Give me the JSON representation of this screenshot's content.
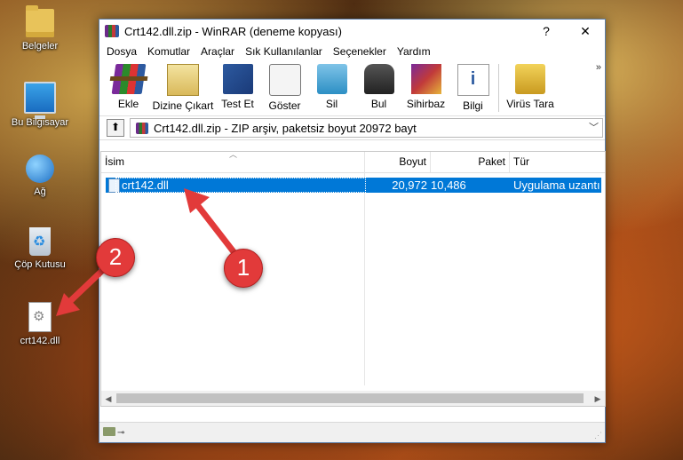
{
  "desktop": {
    "icons": [
      {
        "label": "Belgeler",
        "icon": "folder-icon"
      },
      {
        "label": "Bu Bilgisayar",
        "icon": "computer-icon"
      },
      {
        "label": "Ağ",
        "icon": "network-icon"
      },
      {
        "label": "Çöp Kutusu",
        "icon": "recycle-bin-icon"
      },
      {
        "label": "crt142.dll",
        "icon": "dll-file-icon"
      }
    ]
  },
  "window": {
    "title": "Crt142.dll.zip - WinRAR (deneme kopyası)",
    "help_button": "?",
    "close_button": "✕",
    "menu": [
      "Dosya",
      "Komutlar",
      "Araçlar",
      "Sık Kullanılanlar",
      "Seçenekler",
      "Yardım"
    ],
    "toolbar": [
      {
        "label": "Ekle",
        "icon": "add-archive-icon"
      },
      {
        "label": "Dizine Çıkart",
        "icon": "extract-icon"
      },
      {
        "label": "Test Et",
        "icon": "test-icon"
      },
      {
        "label": "Göster",
        "icon": "view-icon"
      },
      {
        "label": "Sil",
        "icon": "delete-icon"
      },
      {
        "label": "Bul",
        "icon": "find-icon"
      },
      {
        "label": "Sihirbaz",
        "icon": "wizard-icon"
      },
      {
        "label": "Bilgi",
        "icon": "info-icon"
      },
      {
        "label": "Virüs Tara",
        "icon": "virus-scan-icon"
      }
    ],
    "toolbar_more": "»",
    "address": "Crt142.dll.zip - ZIP arşiv, paketsiz boyut 20972 bayt",
    "columns": [
      "İsim",
      "Boyut",
      "Paket",
      "Tür"
    ],
    "files": [
      {
        "name": "crt142.dll",
        "size": "20,972",
        "packed": "10,486",
        "type": "Uygulama uzantı"
      }
    ]
  },
  "callouts": [
    "1",
    "2"
  ],
  "colors": {
    "selection": "#0078d7",
    "callout": "#e23a3a"
  }
}
